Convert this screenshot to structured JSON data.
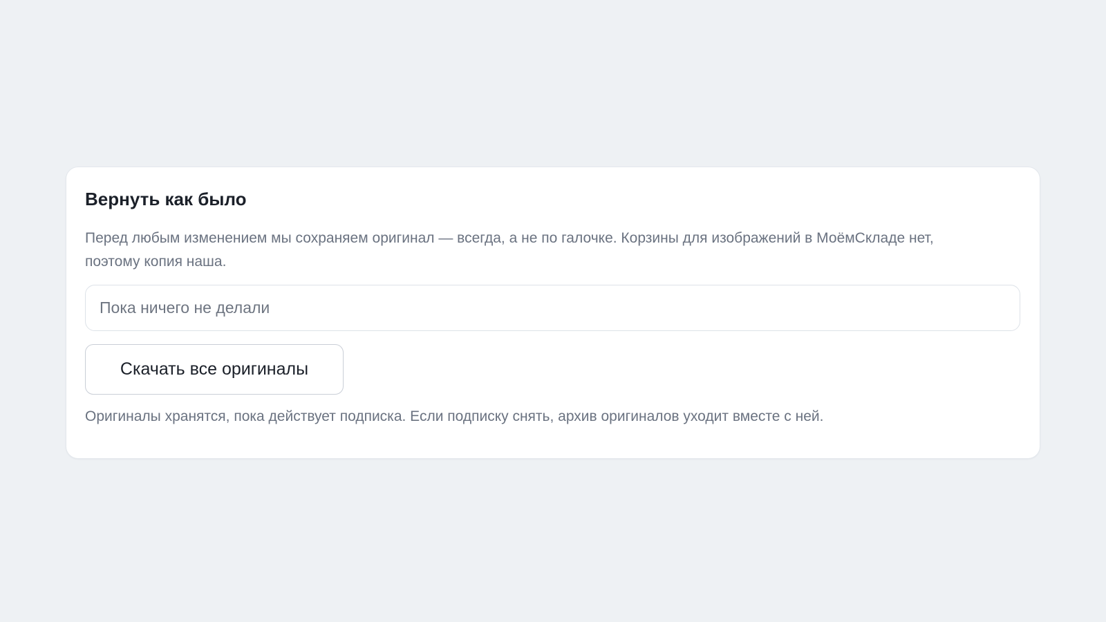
{
  "card": {
    "title": "Вернуть как было",
    "description": "Перед любым изменением мы сохраняем оригинал — всегда, а не по галочке. Корзины для изображений в МоёмСкладе нет, поэтому копия наша.",
    "status_text": "Пока ничего не делали",
    "download_button_label": "Скачать все оригиналы",
    "footnote": "Оригиналы хранятся, пока действует подписка. Если подписку снять, архив оригиналов уходит вместе с ней."
  },
  "colors": {
    "page_background": "#eef1f4",
    "card_background": "#ffffff",
    "title_text": "#1b2029",
    "secondary_text": "#6a7280",
    "border": "#dde2e8"
  }
}
